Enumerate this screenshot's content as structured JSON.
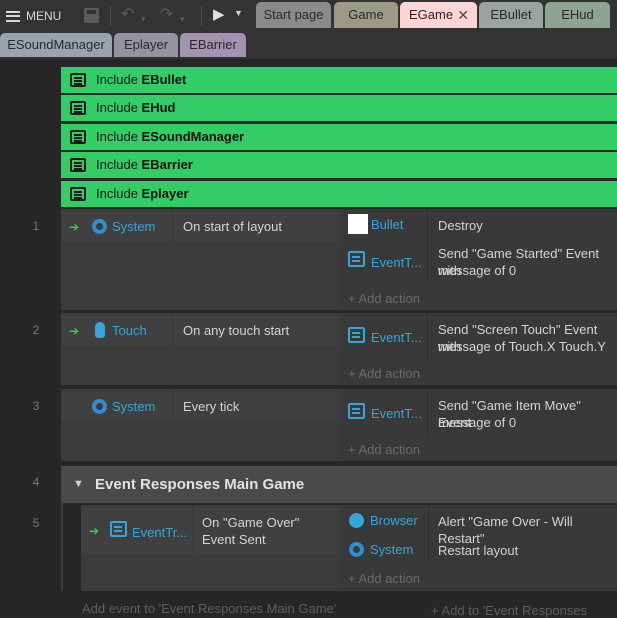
{
  "toolbar": {
    "menu_label": "MENU",
    "tabs_row1": [
      "Start page",
      "Game",
      "EGame",
      "EBullet",
      "EHud"
    ],
    "tabs_row2": [
      "ESoundManager",
      "Eplayer",
      "EBarrier"
    ]
  },
  "includes": [
    {
      "prefix": "Include",
      "name": "EBullet"
    },
    {
      "prefix": "Include",
      "name": "EHud"
    },
    {
      "prefix": "Include",
      "name": "ESoundManager"
    },
    {
      "prefix": "Include",
      "name": "EBarrier"
    },
    {
      "prefix": "Include",
      "name": "Eplayer"
    }
  ],
  "events": [
    {
      "number": "1",
      "object": "System",
      "condition": "On start of layout",
      "actions": [
        {
          "object": "Bullet",
          "text": "Destroy"
        },
        {
          "object": "EventT...",
          "text1": "Send \"Game Started\" Event with",
          "text2": "message of 0"
        }
      ],
      "add_action": "+ Add action"
    },
    {
      "number": "2",
      "object": "Touch",
      "condition": "On any touch start",
      "actions": [
        {
          "object": "EventT...",
          "text1": "Send \"Screen Touch\" Event with",
          "text2": "message of Touch.X Touch.Y"
        }
      ],
      "add_action": "+ Add action"
    },
    {
      "number": "3",
      "object": "System",
      "condition": "Every tick",
      "actions": [
        {
          "object": "EventT...",
          "text1": "Send \"Game Item Move\" Event",
          "text2": "message of 0"
        }
      ],
      "add_action": "+ Add action"
    }
  ],
  "group": {
    "number": "4",
    "title": "Event Responses Main Game"
  },
  "sub_event": {
    "number": "5",
    "object": "EventTr...",
    "condition1": "On \"Game Over\"",
    "condition2": "Event Sent",
    "actions": [
      {
        "object": "Browser",
        "text": "Alert \"Game Over - Will Restart\""
      },
      {
        "object": "System",
        "text": "Restart layout"
      }
    ],
    "add_action": "+ Add action"
  },
  "footer": {
    "add_event": "Add event to 'Event Responses Main Game'",
    "add_to": "+ Add to 'Event Responses Main"
  },
  "colors": {
    "include_green": "#33cc66",
    "object_blue": "#35a6d9",
    "active_tab": "#ffd6d6"
  }
}
